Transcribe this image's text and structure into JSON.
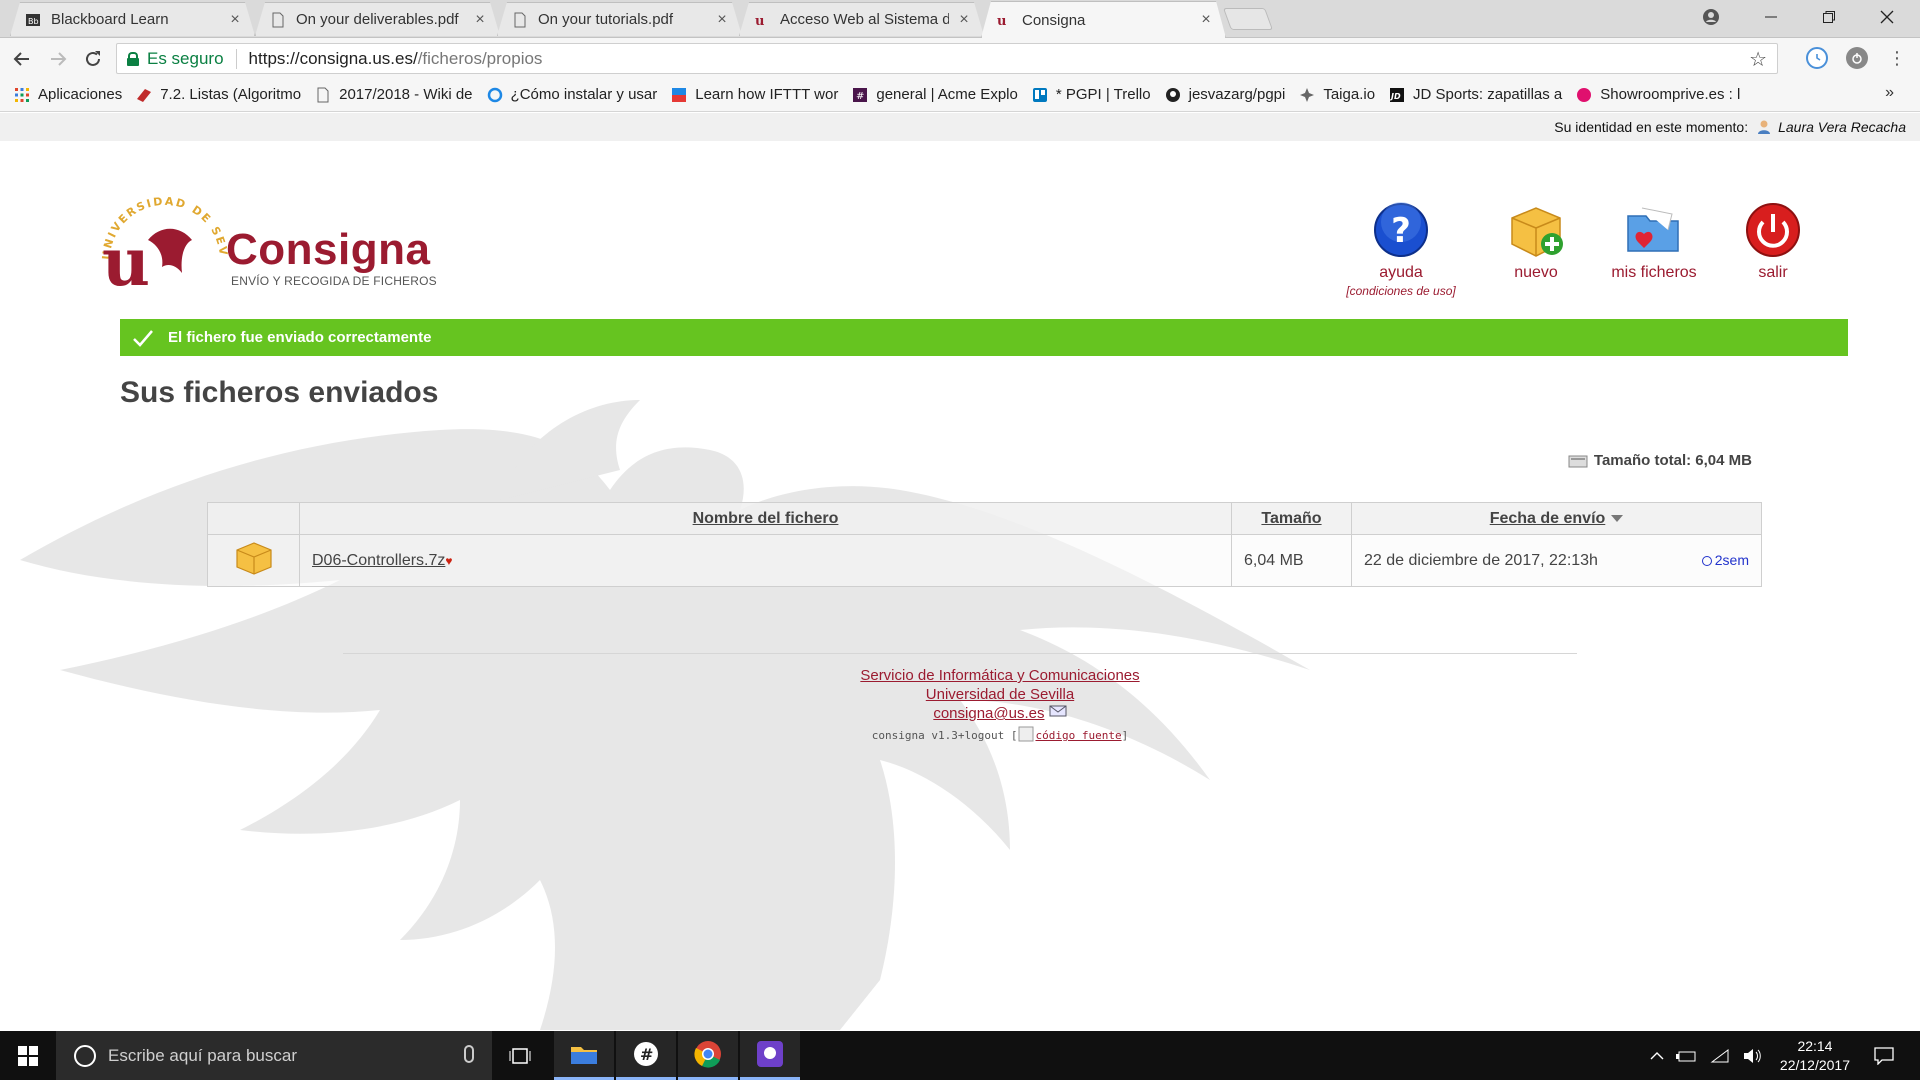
{
  "browser": {
    "tabs": [
      {
        "title": "Blackboard Learn",
        "active": false
      },
      {
        "title": "On your deliverables.pdf",
        "active": false
      },
      {
        "title": "On your tutorials.pdf",
        "active": false
      },
      {
        "title": "Acceso Web al Sistema d",
        "active": false
      },
      {
        "title": "Consigna",
        "active": true
      }
    ],
    "close_glyph": "×",
    "address": {
      "secure_label": "Es seguro",
      "url_host": "https://consigna.us.es/",
      "url_path": "/ficheros/propios"
    },
    "bookmarks": [
      {
        "label": "Aplicaciones",
        "icon": "apps-grid-icon"
      },
      {
        "label": "7.2. Listas (Algoritmo",
        "icon": "book-icon"
      },
      {
        "label": "2017/2018 - Wiki de",
        "icon": "page-icon"
      },
      {
        "label": "¿Cómo instalar y usar",
        "icon": "refresh-blue-icon"
      },
      {
        "label": "Learn how IFTTT wor",
        "icon": "ifttt-icon"
      },
      {
        "label": "general | Acme Explo",
        "icon": "slack-icon"
      },
      {
        "label": "* PGPI | Trello",
        "icon": "trello-icon"
      },
      {
        "label": "jesvazarg/pgpi",
        "icon": "github-icon"
      },
      {
        "label": "Taiga.io",
        "icon": "taiga-icon"
      },
      {
        "label": "JD Sports: zapatillas a",
        "icon": "jd-icon"
      },
      {
        "label": "Showroomprive.es : l",
        "icon": "showroom-icon"
      }
    ],
    "bookmarks_more": "»"
  },
  "identity": {
    "label": "Su identidad en este momento:",
    "user": "Laura Vera Recacha"
  },
  "logo": {
    "title": "Consigna",
    "subtitle": "ENVÍO Y RECOGIDA DE FICHEROS"
  },
  "actions": {
    "help": {
      "label": "ayuda",
      "sub": "condiciones de uso"
    },
    "new": {
      "label": "nuevo"
    },
    "myfiles": {
      "label": "mis ficheros"
    },
    "logout": {
      "label": "salir"
    }
  },
  "banner": {
    "message": "El fichero fue enviado correctamente",
    "color": "#66c420"
  },
  "page": {
    "title": "Sus ficheros enviados",
    "total_label": "Tamaño total:",
    "total_value": "6,04 MB"
  },
  "table": {
    "headers": {
      "name": "Nombre del fichero",
      "size": "Tamaño",
      "date": "Fecha de envío"
    },
    "rows": [
      {
        "name": "D06-Controllers.7z",
        "size": "6,04 MB",
        "date": "22 de diciembre de 2017, 22:13h",
        "relative": "2sem"
      }
    ]
  },
  "footer": {
    "org": "Servicio de Informática y Comunicaciones",
    "university": "Universidad de Sevilla",
    "email": "consigna@us.es",
    "version": "consigna v1.3+logout [",
    "source_link": "código fuente",
    "version_close": "]"
  },
  "taskbar": {
    "search_placeholder": "Escribe aquí para buscar",
    "time": "22:14",
    "date": "22/12/2017"
  },
  "colors": {
    "brand": "#9b1b30",
    "success": "#66c420",
    "link_blue": "#2233cc"
  }
}
